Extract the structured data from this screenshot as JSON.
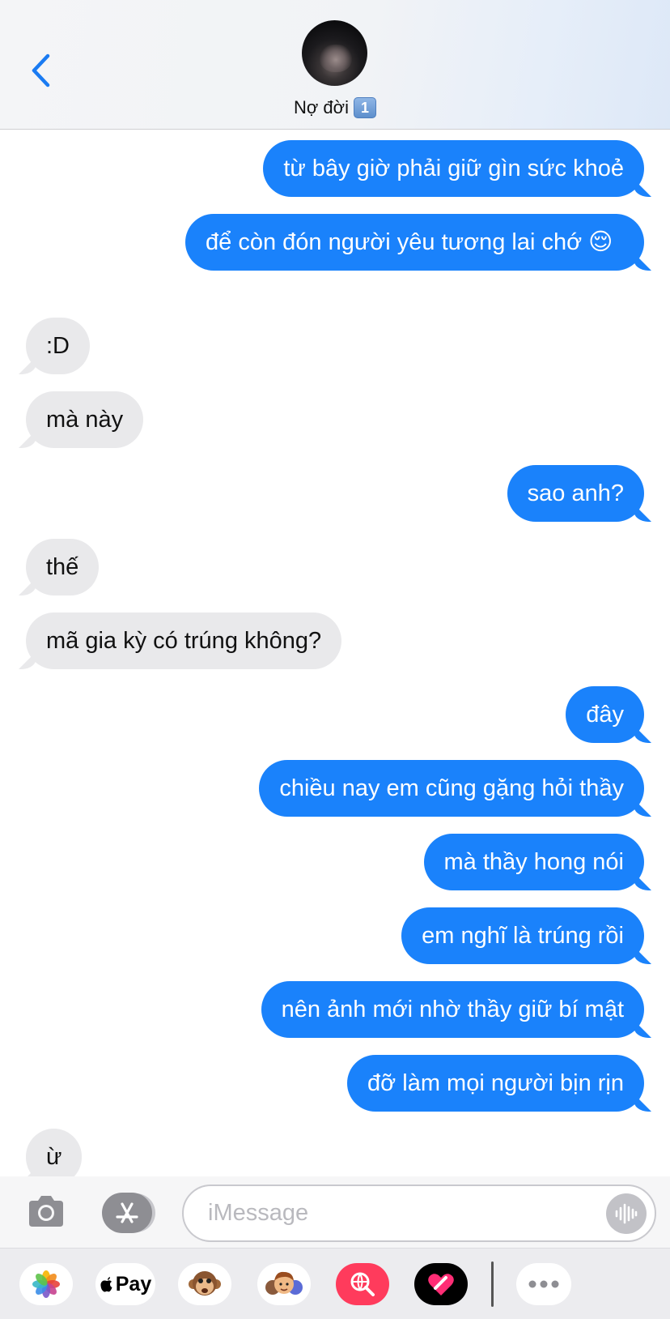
{
  "header": {
    "contact_name": "Nợ đời",
    "badge": "1"
  },
  "messages": [
    {
      "side": "sent",
      "text": "từ bây giờ phải giữ gìn sức khoẻ"
    },
    {
      "side": "sent",
      "text": "để còn đón người yêu tương lai chớ 😌"
    },
    {
      "side": "recv",
      "text": ":D"
    },
    {
      "side": "recv",
      "text": "mà này"
    },
    {
      "side": "sent",
      "text": "sao anh?"
    },
    {
      "side": "recv",
      "text": "thế"
    },
    {
      "side": "recv",
      "text": "mã gia kỳ có trúng không?"
    },
    {
      "side": "sent",
      "text": "đây"
    },
    {
      "side": "sent",
      "text": "chiều nay em cũng gặng hỏi thầy"
    },
    {
      "side": "sent",
      "text": "mà thầy hong nói"
    },
    {
      "side": "sent",
      "text": "em nghĩ là trúng rồi"
    },
    {
      "side": "sent",
      "text": "nên ảnh mới nhờ thầy giữ bí mật"
    },
    {
      "side": "sent",
      "text": "đỡ làm mọi người bịn rịn"
    },
    {
      "side": "recv",
      "text": "ừ"
    }
  ],
  "composer": {
    "placeholder": "iMessage"
  },
  "app_drawer": {
    "pay_label": "Pay",
    "apps": [
      "photos-app-icon",
      "apple-pay-app-icon",
      "animoji-app-icon",
      "memoji-app-icon",
      "web-search-app-icon",
      "digital-touch-app-icon",
      "more-apps-icon"
    ]
  },
  "colors": {
    "sent_bubble": "#1a82fb",
    "recv_bubble": "#e9e9eb",
    "accent": "#1a7bf2"
  }
}
